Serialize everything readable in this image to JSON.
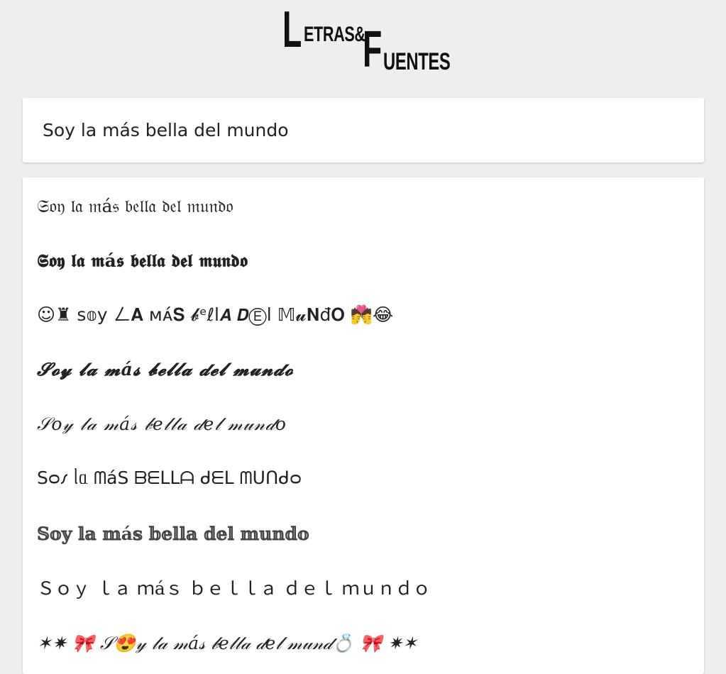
{
  "logo": {
    "line1_initial": "L",
    "line1_rest": "ETRAS&",
    "line2_initial": "F",
    "line2_rest": "UENTES"
  },
  "input": {
    "value": "Soy la más bella del mundo"
  },
  "results": [
    "𝔖𝔬𝔶 𝔩𝔞 𝔪á𝔰 𝔟𝔢𝔩𝔩𝔞 𝔡𝔢𝔩 𝔪𝔲𝔫𝔡𝔬",
    "𝕾𝖔𝖞 𝖑𝖆 𝖒á𝖘 𝖇𝖊𝖑𝖑𝖆 𝖉𝖊𝖑 𝖒𝖚𝖓𝖉𝖔",
    "☺♜  ꜱ𝕠y ㄥ𝐀 ᴍᴀ́𝐒 𝓫ᵉℓl𝘼 𝘿Ⓔl 𝕄𝓾𝐍đ𝐎  💏😂",
    "𝓢𝓸𝔂 𝓵𝓪 𝓶á𝓼 𝓫𝓮𝓵𝓵𝓪 𝓭𝓮𝓵 𝓶𝓾𝓷𝓭𝓸",
    "𝒮𝑜𝓎 𝓁𝒶 𝓂á𝓈 𝒷𝑒𝓁𝓁𝒶 𝒹𝑒𝓁 𝓂𝓊𝓃𝒹𝑜",
    "Sᴑ𐑥 ᥣᥲ ᗰáS ᗷᗴᒪᒪᗩ ᑯᗴᒪ ᗰᑌᑎᑯᴑ",
    "𝕊𝕠𝕪 𝕝𝕒 𝕞á𝕤 𝕓𝕖𝕝𝕝𝕒 𝕕𝕖𝕝 𝕞𝕦𝕟𝕕𝕠",
    "Ｓｏｙ ｌａ ｍáｓ ｂｅｌｌａ ｄｅｌ ｍｕｎｄｏ",
    "✶✷  🎀  𝒮😍𝓎 𝓁𝒶 𝓂á𝓈 𝒷𝑒𝓁𝓁𝒶 𝒹𝑒𝓁 𝓂𝓊𝓃𝒹💍  🎀  ✷✶"
  ]
}
